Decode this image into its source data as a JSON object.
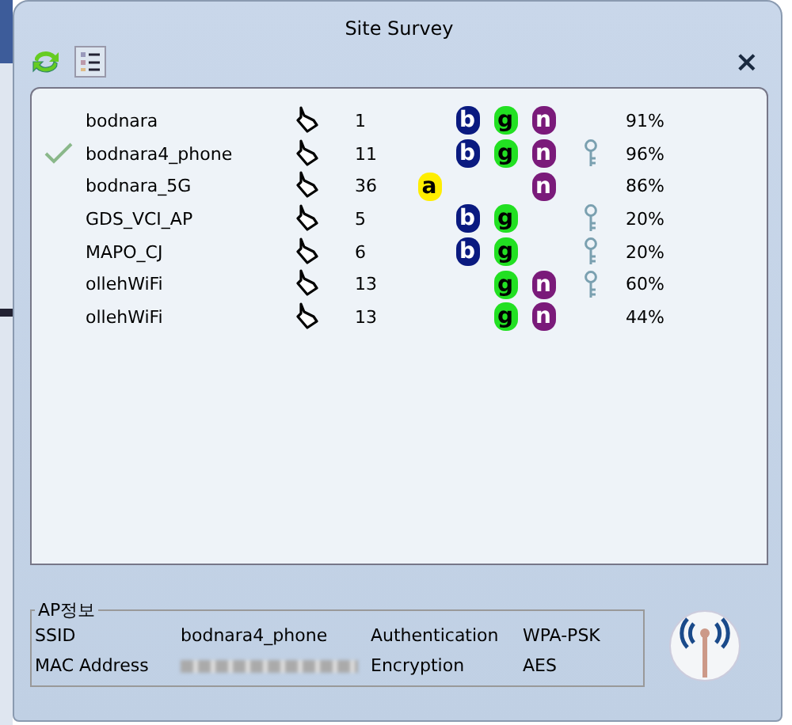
{
  "window": {
    "title": "Site Survey",
    "close": "×"
  },
  "networks": [
    {
      "ssid": "bodnara",
      "connected": false,
      "channel": "1",
      "bands": [
        {
          "kind": "b",
          "letter": "b"
        },
        {
          "kind": "g",
          "letter": "g"
        },
        {
          "kind": "n",
          "letter": "n"
        }
      ],
      "secured": false,
      "signal": "91%"
    },
    {
      "ssid": "bodnara4_phone",
      "connected": true,
      "channel": "11",
      "bands": [
        {
          "kind": "b",
          "letter": "b"
        },
        {
          "kind": "g",
          "letter": "g"
        },
        {
          "kind": "n",
          "letter": "n"
        }
      ],
      "secured": true,
      "signal": "96%"
    },
    {
      "ssid": "bodnara_5G",
      "connected": false,
      "channel": "36",
      "bands": [
        {
          "kind": "a",
          "letter": "a"
        },
        {
          "kind": "n",
          "letter": "n"
        }
      ],
      "secured": false,
      "signal": "86%"
    },
    {
      "ssid": "GDS_VCI_AP",
      "connected": false,
      "channel": "5",
      "bands": [
        {
          "kind": "b",
          "letter": "b"
        },
        {
          "kind": "g",
          "letter": "g"
        }
      ],
      "secured": true,
      "signal": "20%"
    },
    {
      "ssid": "MAPO_CJ",
      "connected": false,
      "channel": "6",
      "bands": [
        {
          "kind": "b",
          "letter": "b"
        },
        {
          "kind": "g",
          "letter": "g"
        }
      ],
      "secured": true,
      "signal": "20%"
    },
    {
      "ssid": "ollehWiFi",
      "connected": false,
      "channel": "13",
      "bands": [
        {
          "kind": "g",
          "letter": "g"
        },
        {
          "kind": "n",
          "letter": "n"
        }
      ],
      "secured": true,
      "signal": "60%"
    },
    {
      "ssid": "ollehWiFi",
      "connected": false,
      "channel": "13",
      "bands": [
        {
          "kind": "g",
          "letter": "g"
        },
        {
          "kind": "n",
          "letter": "n"
        }
      ],
      "secured": false,
      "signal": "44%"
    }
  ],
  "ap_info": {
    "title": "AP정보",
    "fields": [
      {
        "label": "SSID",
        "value": "bodnara4_phone",
        "label2": "Authentication",
        "value2": "WPA-PSK"
      },
      {
        "label": "MAC Address",
        "label2": "Encryption",
        "value2": "AES"
      }
    ]
  }
}
